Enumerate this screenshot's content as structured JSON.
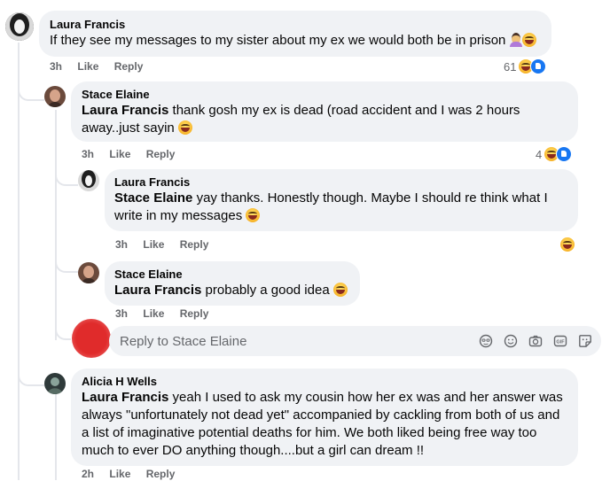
{
  "comments": [
    {
      "author": "Laura Francis",
      "text": "If they see my messages to my sister about my ex we would both be in prison",
      "time": "3h",
      "like_label": "Like",
      "reply_label": "Reply",
      "reaction_count": "61",
      "reactions": [
        "haha-icon",
        "like-icon"
      ]
    },
    {
      "author": "Stace Elaine",
      "mention": "Laura Francis",
      "text": "thank gosh my ex is dead (road accident and I was 2 hours away..just sayin",
      "time": "3h",
      "like_label": "Like",
      "reply_label": "Reply",
      "reaction_count": "4",
      "reactions": [
        "haha-icon",
        "like-icon"
      ]
    },
    {
      "author": "Laura Francis",
      "mention": "Stace Elaine",
      "text": "yay thanks. Honestly though. Maybe I should re think what I write in my messages",
      "time": "3h",
      "like_label": "Like",
      "reply_label": "Reply",
      "reactions": [
        "haha-icon"
      ]
    },
    {
      "author": "Stace Elaine",
      "mention": "Laura Francis",
      "text": "probably a good idea",
      "time": "3h",
      "like_label": "Like",
      "reply_label": "Reply"
    },
    {
      "author": "Alicia H Wells",
      "mention": "Laura Francis",
      "text": "yeah I used to ask my cousin how her ex was and her answer was always \"unfortunately not dead yet\" accompanied by cackling from both of us and a list of imaginative potential deaths for him. We both liked being free way too much to ever DO anything though....but a girl can dream !!",
      "time": "2h",
      "like_label": "Like",
      "reply_label": "Reply"
    }
  ],
  "reply_box": {
    "placeholder": "Reply to Stace Elaine",
    "tools": [
      "avatar-sticker-icon",
      "emoji-icon",
      "camera-icon",
      "gif-icon",
      "sticker-icon"
    ]
  },
  "colors": {
    "bubble": "#f0f2f5",
    "meta_text": "#65676b",
    "like_blue": "#1877f2",
    "haha_yellow": "#f7b125",
    "user_avatar_red": "#e02b2b"
  }
}
